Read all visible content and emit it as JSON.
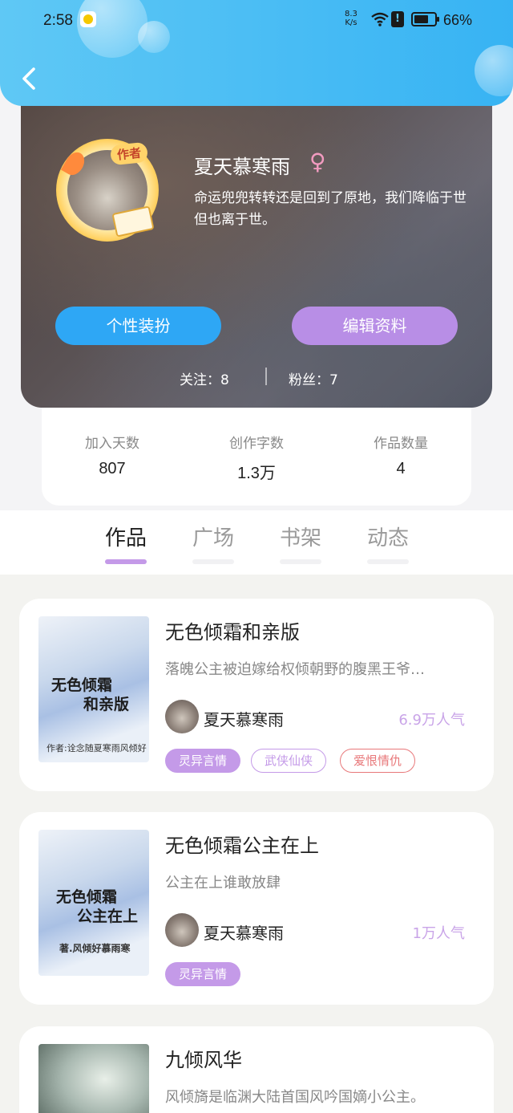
{
  "status_bar": {
    "time": "2:58",
    "net_speed_top": "8.3",
    "net_speed_unit": "K/s",
    "sim_icon": "!",
    "battery": "66%"
  },
  "profile": {
    "name": "夏天慕寒雨",
    "gender_symbol": "♀",
    "author_badge": "作者",
    "bio": "命运兜兜转转还是回到了原地，我们降临于世但也离于世。",
    "buttons": {
      "dress_up": "个性装扮",
      "edit_profile": "编辑资料"
    },
    "follow": {
      "label": "关注：",
      "count": "8"
    },
    "fans": {
      "label": "粉丝：",
      "count": "7"
    }
  },
  "stats": [
    {
      "label": "加入天数",
      "value": "807"
    },
    {
      "label": "创作字数",
      "value": "1.3万"
    },
    {
      "label": "作品数量",
      "value": "4"
    }
  ],
  "tabs": [
    {
      "label": "作品",
      "active": true
    },
    {
      "label": "广场",
      "active": false
    },
    {
      "label": "书架",
      "active": false
    },
    {
      "label": "动态",
      "active": false
    }
  ],
  "works": [
    {
      "title": "无色倾霜和亲版",
      "desc": "落魄公主被迫嫁给权倾朝野的腹黑王爷…",
      "author": "夏天慕寒雨",
      "popularity": "6.9万人气",
      "cover_line1": "无色倾霜",
      "cover_line2": "和亲版",
      "cover_author": "作者:诠念随夏寒雨风倾好",
      "tags": [
        "灵异言情",
        "武侠仙侠",
        "爱恨情仇"
      ]
    },
    {
      "title": "无色倾霜公主在上",
      "desc": "公主在上谁敢放肆",
      "author": "夏天慕寒雨",
      "popularity": "1万人气",
      "cover_line1": "无色倾霜",
      "cover_line2": "公主在上",
      "cover_author": "著.风倾好慕雨寒",
      "tags": [
        "灵异言情"
      ]
    },
    {
      "title": "九倾风华",
      "desc": "风倾旖是临渊大陆首国风吟国嫡小公主。"
    }
  ],
  "colors": {
    "header_blue": "#37b3f3",
    "accent_purple": "#c49ae8",
    "button_blue": "#2ea7f5",
    "tag_red": "#e8787a"
  }
}
